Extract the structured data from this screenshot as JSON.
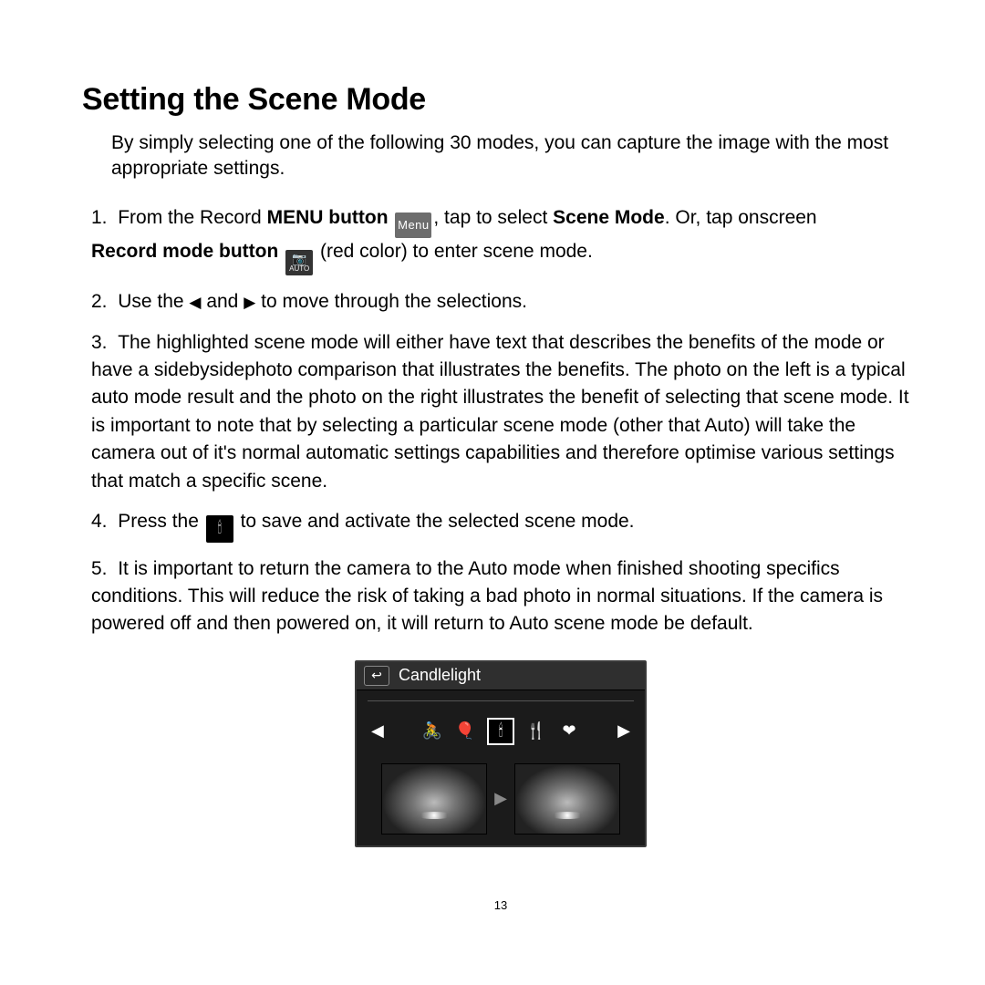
{
  "heading": "Setting the Scene Mode",
  "intro": "By simply selecting one of the following 30 modes, you can capture the image with the most appropriate settings.",
  "step1": {
    "a": "From the Record ",
    "menu_button": "MENU button",
    "menu_icon_label": "Menu",
    "b": ", tap to select ",
    "scene_mode": "Scene Mode",
    "c": ". Or, tap onscreen ",
    "record_mode_button": "Record mode button",
    "auto_icon_label": "AUTO",
    "d": " (red color) to enter scene mode."
  },
  "step2": {
    "a": "Use the ",
    "b": " and ",
    "c": " to move through the selections."
  },
  "step3": "The highlighted scene mode will either have text that describes the benefits of the mode or have a sidebysidephoto comparison that illustrates the benefits. The photo on the left is a typical auto mode result and the photo on the right illustrates the benefit of selecting that scene mode. It is important to note that by selecting a particular scene mode (other that Auto) will take the camera out of it's normal automatic settings capabilities and therefore optimise various settings that match a specific scene.",
  "step4": {
    "a": "Press the ",
    "b": " to save and activate the selected scene mode."
  },
  "step5": "It is important to return the camera to the Auto mode when finished shooting specifics conditions. This will reduce the risk of taking a bad photo in normal situations. If the camera is powered off and then powered on, it will return to Auto scene mode be default.",
  "screenshot": {
    "title": "Candlelight",
    "back_glyph": "↩",
    "left_glyph": "◀",
    "right_glyph": "▶",
    "modes": [
      "🚴",
      "🎈",
      "🕯",
      "🍴",
      "❤"
    ],
    "selected_index": 2,
    "mid_arrow": "▶"
  },
  "glyphs": {
    "tri_left": "◀",
    "tri_right": "▶",
    "camera": "📷",
    "candle": "🕯"
  },
  "page_number": "13"
}
